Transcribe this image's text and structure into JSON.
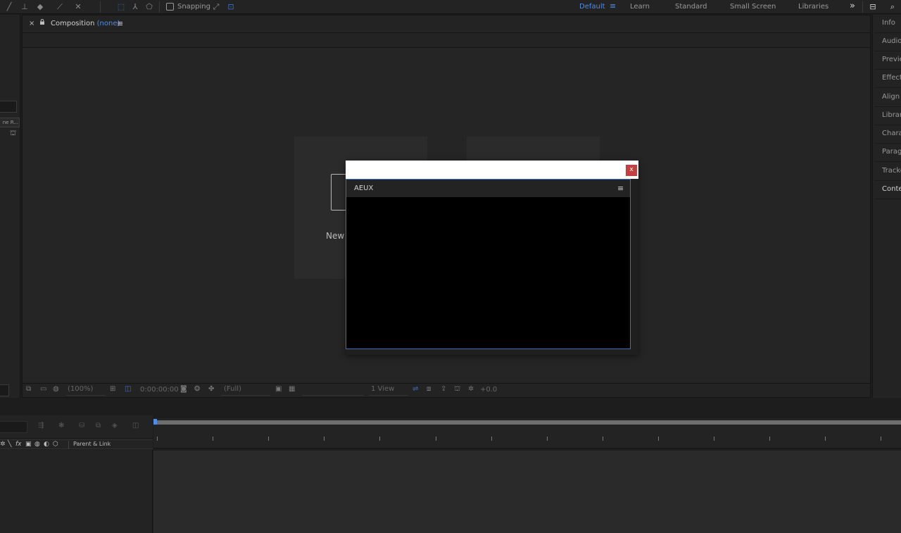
{
  "toolbar": {
    "snapping_label": "Snapping",
    "workspaces": [
      "Default",
      "Learn",
      "Standard",
      "Small Screen",
      "Libraries"
    ],
    "active_workspace": "Default",
    "overflow_glyph": "»"
  },
  "left_panel": {
    "column_header": "ne R..."
  },
  "composition": {
    "close_glyph": "×",
    "tab_title": "Composition",
    "tab_value": "(none)",
    "menu_glyph": "≡",
    "new_card_label": "New",
    "footer": {
      "zoom": "(100%)",
      "timecode": "0:00:00:00",
      "resolution": "(Full)",
      "views": "1 View",
      "exposure": "+0.0"
    }
  },
  "right_panel": {
    "items": [
      "Info",
      "Audio",
      "Previe",
      "Effects",
      "Align",
      "Librari",
      "Charac",
      "Paragr",
      "Tracke",
      "Conter"
    ]
  },
  "timeline": {
    "parent_link_label": "Parent & Link"
  },
  "aeux_dialog": {
    "close_glyph": "x",
    "panel_title": "AEUX",
    "menu_glyph": "≡"
  },
  "colors": {
    "accent_blue": "#4d8ee8",
    "close_red": "#c44040",
    "panel_bg": "#232323"
  }
}
